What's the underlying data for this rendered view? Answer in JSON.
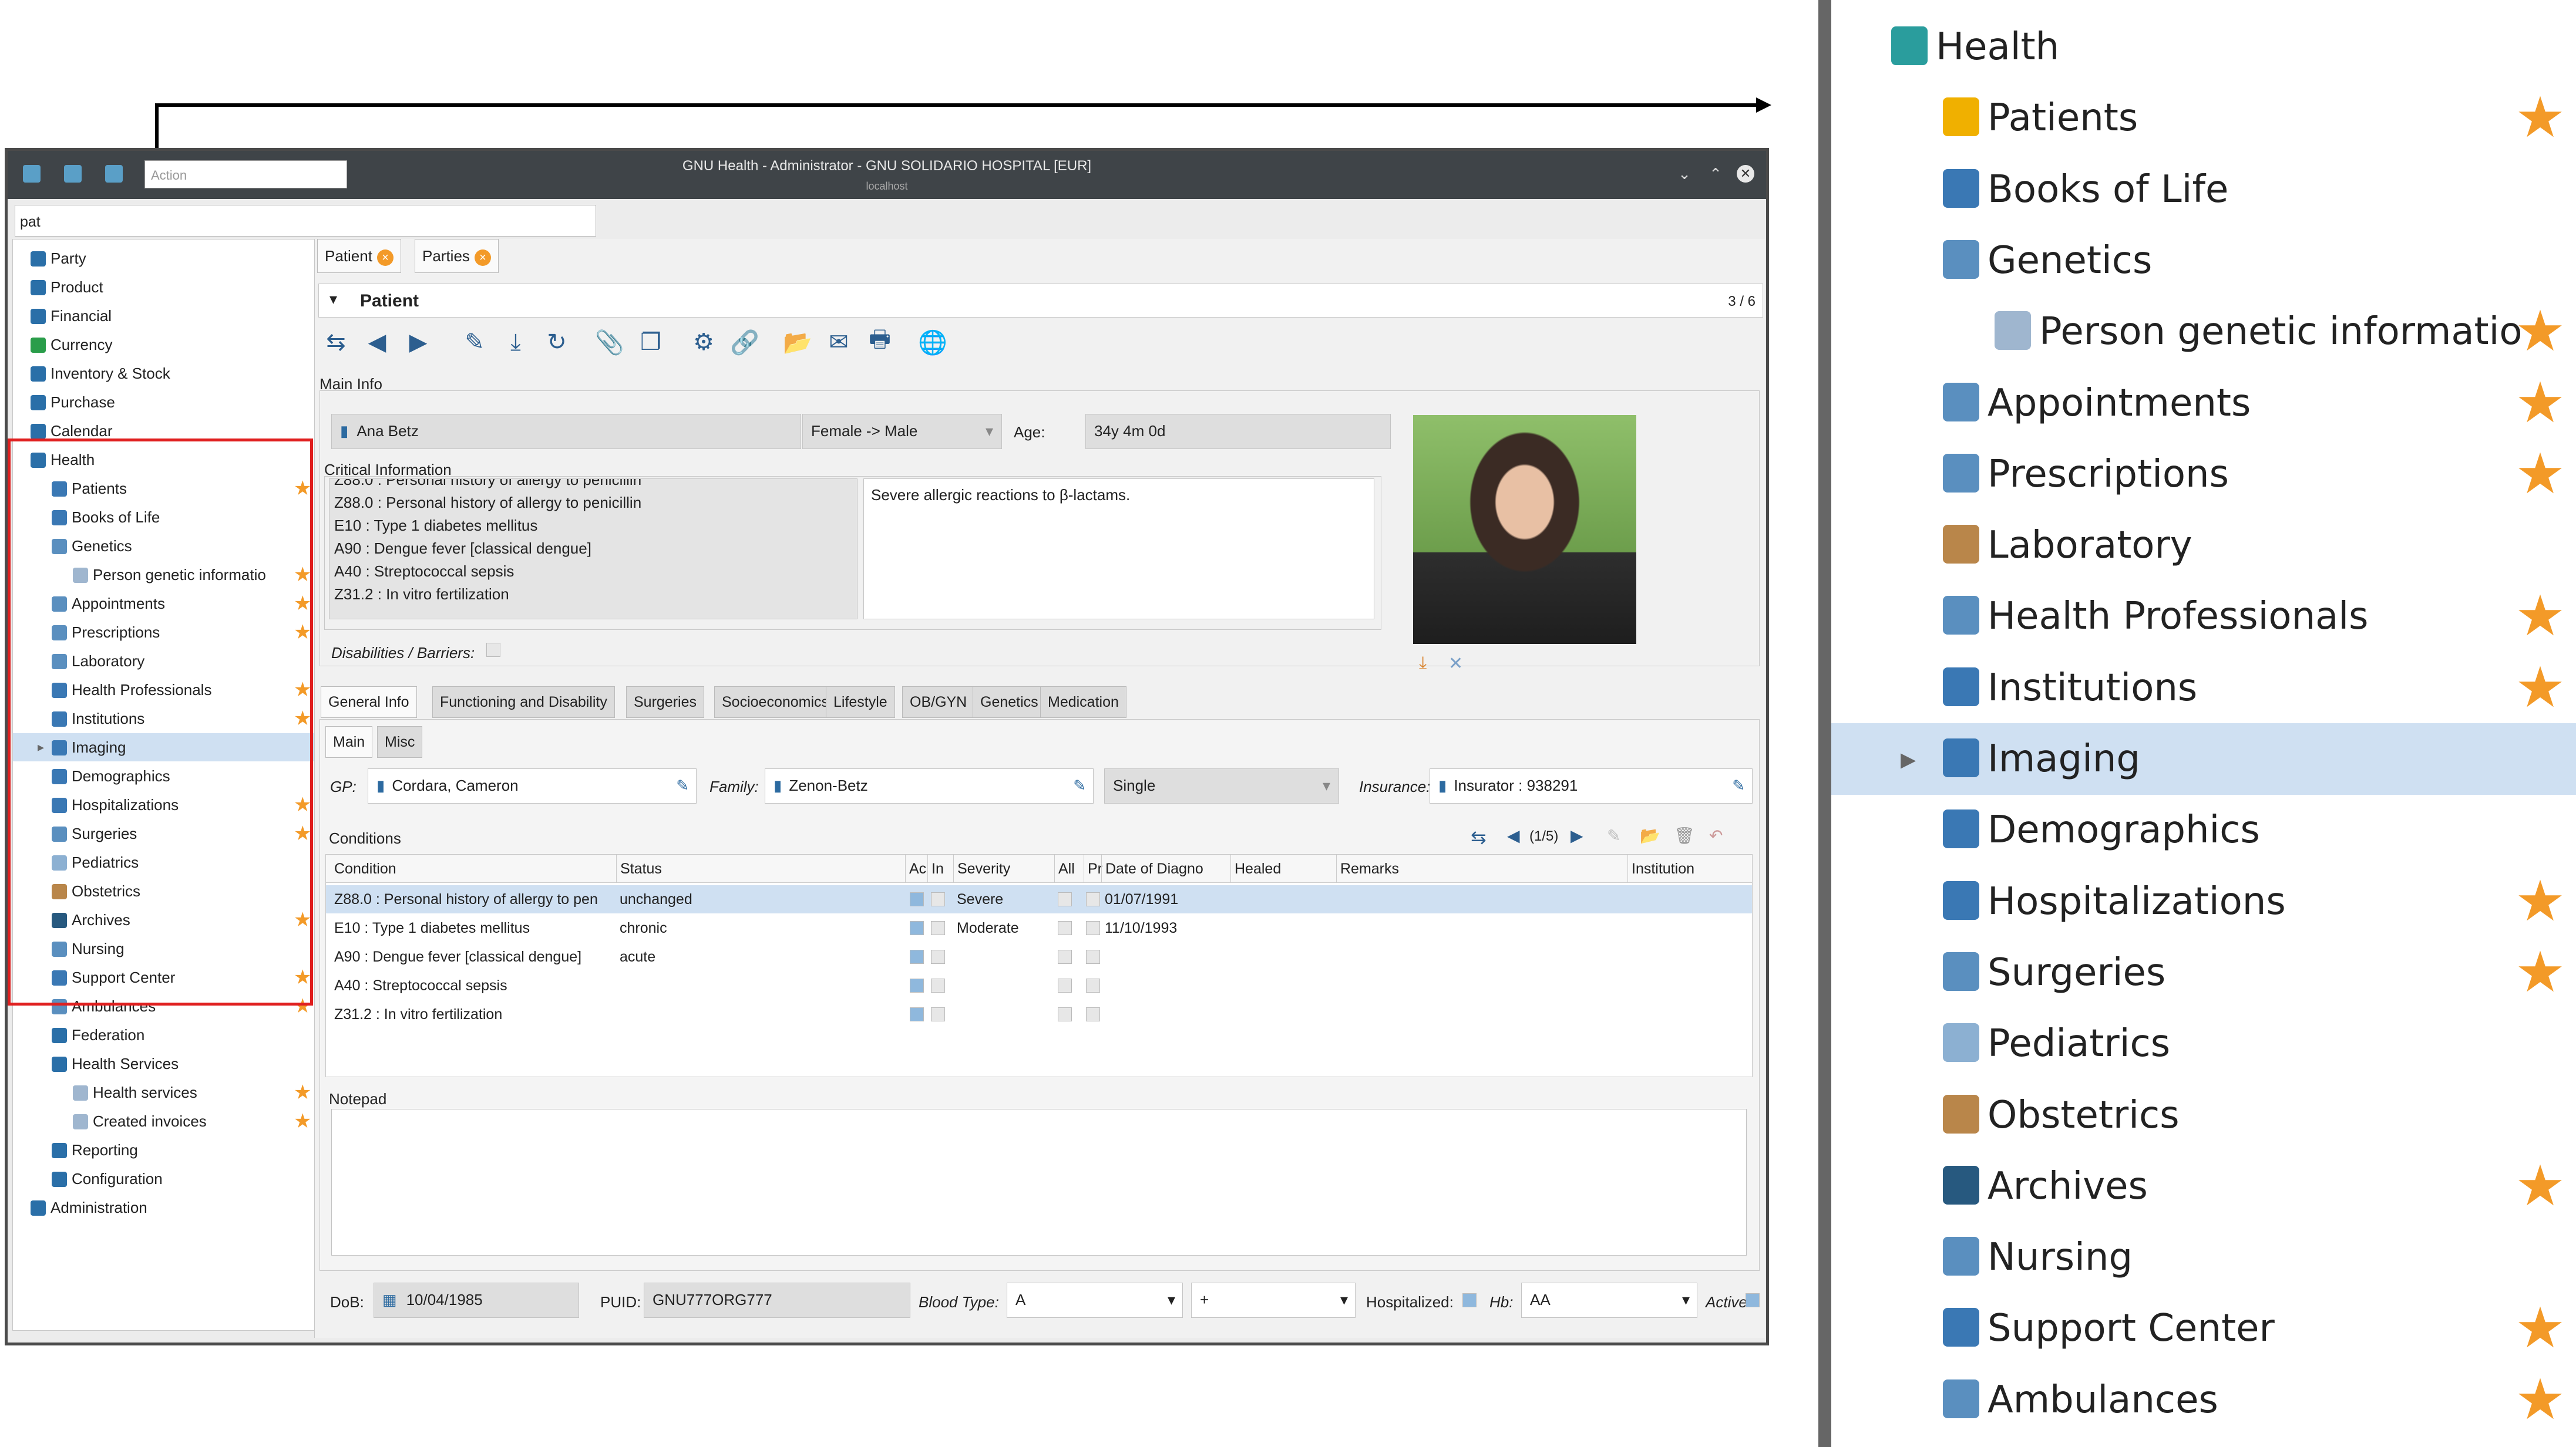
{
  "window": {
    "title": "GNU Health - Administrator - GNU SOLIDARIO HOSPITAL [EUR]",
    "subtitle": "localhost",
    "action_placeholder": "Action",
    "search_value": "pat"
  },
  "tree": [
    {
      "label": "Party",
      "star": false
    },
    {
      "label": "Product",
      "star": false
    },
    {
      "label": "Financial",
      "star": false
    },
    {
      "label": "Currency",
      "star": false
    },
    {
      "label": "Inventory & Stock",
      "star": false
    },
    {
      "label": "Purchase",
      "star": false
    },
    {
      "label": "Calendar",
      "star": false
    },
    {
      "label": "Health",
      "star": false
    },
    {
      "label": "Patients",
      "star": true
    },
    {
      "label": "Books of Life",
      "star": false
    },
    {
      "label": "Genetics",
      "star": false
    },
    {
      "label": "Person genetic informatio",
      "star": true
    },
    {
      "label": "Appointments",
      "star": true
    },
    {
      "label": "Prescriptions",
      "star": true
    },
    {
      "label": "Laboratory",
      "star": false
    },
    {
      "label": "Health Professionals",
      "star": true
    },
    {
      "label": "Institutions",
      "star": true
    },
    {
      "label": "Imaging",
      "star": false
    },
    {
      "label": "Demographics",
      "star": false
    },
    {
      "label": "Hospitalizations",
      "star": true
    },
    {
      "label": "Surgeries",
      "star": true
    },
    {
      "label": "Pediatrics",
      "star": false
    },
    {
      "label": "Obstetrics",
      "star": false
    },
    {
      "label": "Archives",
      "star": true
    },
    {
      "label": "Nursing",
      "star": false
    },
    {
      "label": "Support Center",
      "star": true
    },
    {
      "label": "Ambulances",
      "star": true
    },
    {
      "label": "Federation",
      "star": false
    },
    {
      "label": "Health Services",
      "star": false
    },
    {
      "label": "Health services",
      "star": true
    },
    {
      "label": "Created invoices",
      "star": true
    },
    {
      "label": "Reporting",
      "star": false
    },
    {
      "label": "Configuration",
      "star": false
    },
    {
      "label": "Administration",
      "star": false
    }
  ],
  "tabs": [
    {
      "label": "Patient"
    },
    {
      "label": "Parties"
    }
  ],
  "form": {
    "title": "Patient",
    "record_count": "3 / 6",
    "main_info": "Main Info",
    "name": "Ana Betz",
    "gender": "Female -> Male",
    "age_label": "Age:",
    "age": "34y 4m 0d",
    "critical_info": "Critical Information",
    "critical_list": [
      "Z88.0 : Personal history of allergy to penicillin",
      "E10 : Type 1 diabetes mellitus",
      "A90 : Dengue fever [classical dengue]",
      "A40 : Streptococcal sepsis",
      "Z31.2 : In vitro fertilization"
    ],
    "critical_cut": "Z88.0 : Personal history of allergy to penicillin",
    "critical_note": "Severe allergic reactions to β-lactams.",
    "disabilities": "Disabilities / Barriers:",
    "subtabs": [
      "General Info",
      "Functioning and Disability",
      "Surgeries",
      "Socioeconomics",
      "Lifestyle",
      "OB/GYN",
      "Genetics",
      "Medication"
    ],
    "inner_tabs": [
      "Main",
      "Misc"
    ],
    "gp_label": "GP:",
    "gp": "Cordara, Cameron",
    "family_label": "Family:",
    "family": "Zenon-Betz",
    "marital": "Single",
    "insurance_label": "Insurance:",
    "insurance": "Insurator : 938291",
    "conditions_label": "Conditions",
    "conditions_pager": "(1/5)",
    "cond_headers": [
      "Condition",
      "Status",
      "Ac",
      "In",
      "Severity",
      "All",
      "Pr",
      "Date of Diagno",
      "Healed",
      "Remarks",
      "Institution"
    ],
    "cond_rows": [
      {
        "condition": "Z88.0 : Personal history of allergy to pen",
        "status": "unchanged",
        "severity": "Severe",
        "date": "01/07/1991"
      },
      {
        "condition": "E10 : Type 1 diabetes mellitus",
        "status": "chronic",
        "severity": "Moderate",
        "date": "11/10/1993"
      },
      {
        "condition": "A90 : Dengue fever [classical dengue]",
        "status": "acute",
        "severity": "",
        "date": ""
      },
      {
        "condition": "A40 : Streptococcal sepsis",
        "status": "",
        "severity": "",
        "date": ""
      },
      {
        "condition": "Z31.2 : In vitro fertilization",
        "status": "",
        "severity": "",
        "date": ""
      }
    ],
    "notepad": "Notepad",
    "dob_label": "DoB:",
    "dob": "10/04/1985",
    "puid_label": "PUID:",
    "puid": "GNU777ORG777",
    "blood_label": "Blood Type:",
    "blood": "A",
    "rh": "+",
    "hosp_label": "Hospitalized:",
    "hb_label": "Hb:",
    "hb": "AA",
    "active_label": "Active:"
  },
  "zoom": [
    {
      "label": "Health",
      "star": false
    },
    {
      "label": "Patients",
      "star": true
    },
    {
      "label": "Books of Life",
      "star": false
    },
    {
      "label": "Genetics",
      "star": false
    },
    {
      "label": "Person genetic informatio",
      "star": true
    },
    {
      "label": "Appointments",
      "star": true
    },
    {
      "label": "Prescriptions",
      "star": true
    },
    {
      "label": "Laboratory",
      "star": false
    },
    {
      "label": "Health Professionals",
      "star": true
    },
    {
      "label": "Institutions",
      "star": true
    },
    {
      "label": "Imaging",
      "star": false
    },
    {
      "label": "Demographics",
      "star": false
    },
    {
      "label": "Hospitalizations",
      "star": true
    },
    {
      "label": "Surgeries",
      "star": true
    },
    {
      "label": "Pediatrics",
      "star": false
    },
    {
      "label": "Obstetrics",
      "star": false
    },
    {
      "label": "Archives",
      "star": true
    },
    {
      "label": "Nursing",
      "star": false
    },
    {
      "label": "Support Center",
      "star": true
    },
    {
      "label": "Ambulances",
      "star": true
    }
  ],
  "colors": {
    "accent": "#f39a28",
    "highlight": "#cfe0f2",
    "redbox": "#e01f1f",
    "titlebar": "#3f4448"
  }
}
